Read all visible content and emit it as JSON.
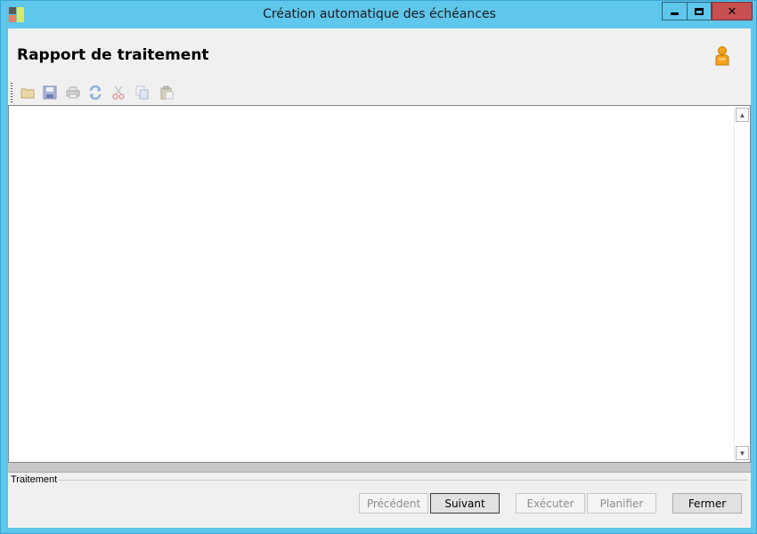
{
  "window": {
    "title": "Création automatique des échéances",
    "controls": {
      "close_symbol": "✕"
    }
  },
  "header": {
    "title": "Rapport de traitement",
    "user_icon": "user-icon"
  },
  "toolbar": {
    "buttons": [
      {
        "name": "open-folder-icon"
      },
      {
        "name": "save-icon"
      },
      {
        "name": "print-icon"
      },
      {
        "name": "refresh-icon"
      },
      {
        "name": "cut-icon"
      },
      {
        "name": "copy-icon"
      },
      {
        "name": "paste-icon"
      }
    ]
  },
  "report": {
    "content": ""
  },
  "processing": {
    "label": "Traitement"
  },
  "buttons": {
    "previous": "Précédent",
    "next": "Suivant",
    "execute": "Exécuter",
    "schedule": "Planifier",
    "close": "Fermer"
  },
  "colors": {
    "titlebar": "#5fc6ec",
    "close_button": "#c75050",
    "client_bg": "#f0f0f0"
  }
}
